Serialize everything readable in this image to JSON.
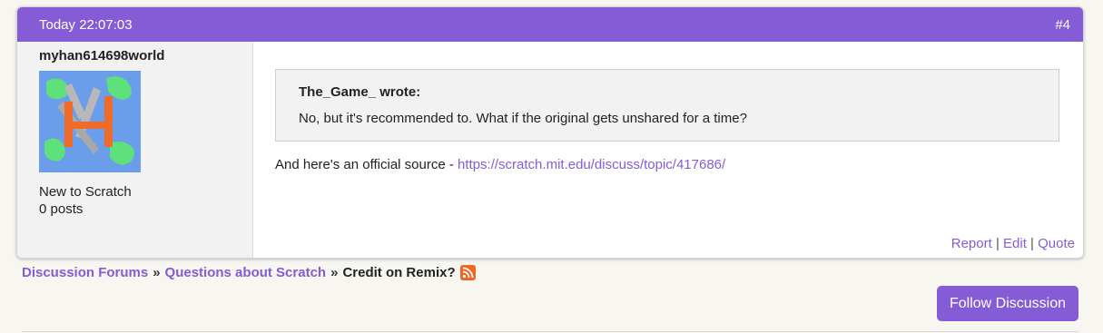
{
  "post": {
    "timestamp": "Today 22:07:03",
    "number": "#4",
    "author": {
      "name": "myhan614698world",
      "status": "New to Scratch",
      "post_count": "0 posts"
    },
    "quote": {
      "author_line": "The_Game_ wrote:",
      "text": "No, but it's recommended to. What if the original gets unshared for a time?"
    },
    "reply": {
      "text": "And here's an official source - ",
      "link": "https://scratch.mit.edu/discuss/topic/417686/"
    },
    "actions": {
      "report": "Report",
      "edit": "Edit",
      "quote": "Quote",
      "separator": "|"
    }
  },
  "breadcrumb": {
    "items": [
      "Discussion Forums",
      "Questions about Scratch"
    ],
    "current": "Credit on Remix?",
    "separator": "»"
  },
  "follow_button": "Follow Discussion",
  "colors": {
    "accent": "#855cd6",
    "rss": "#f26522"
  },
  "icons": [
    "rss-feed-icon"
  ]
}
